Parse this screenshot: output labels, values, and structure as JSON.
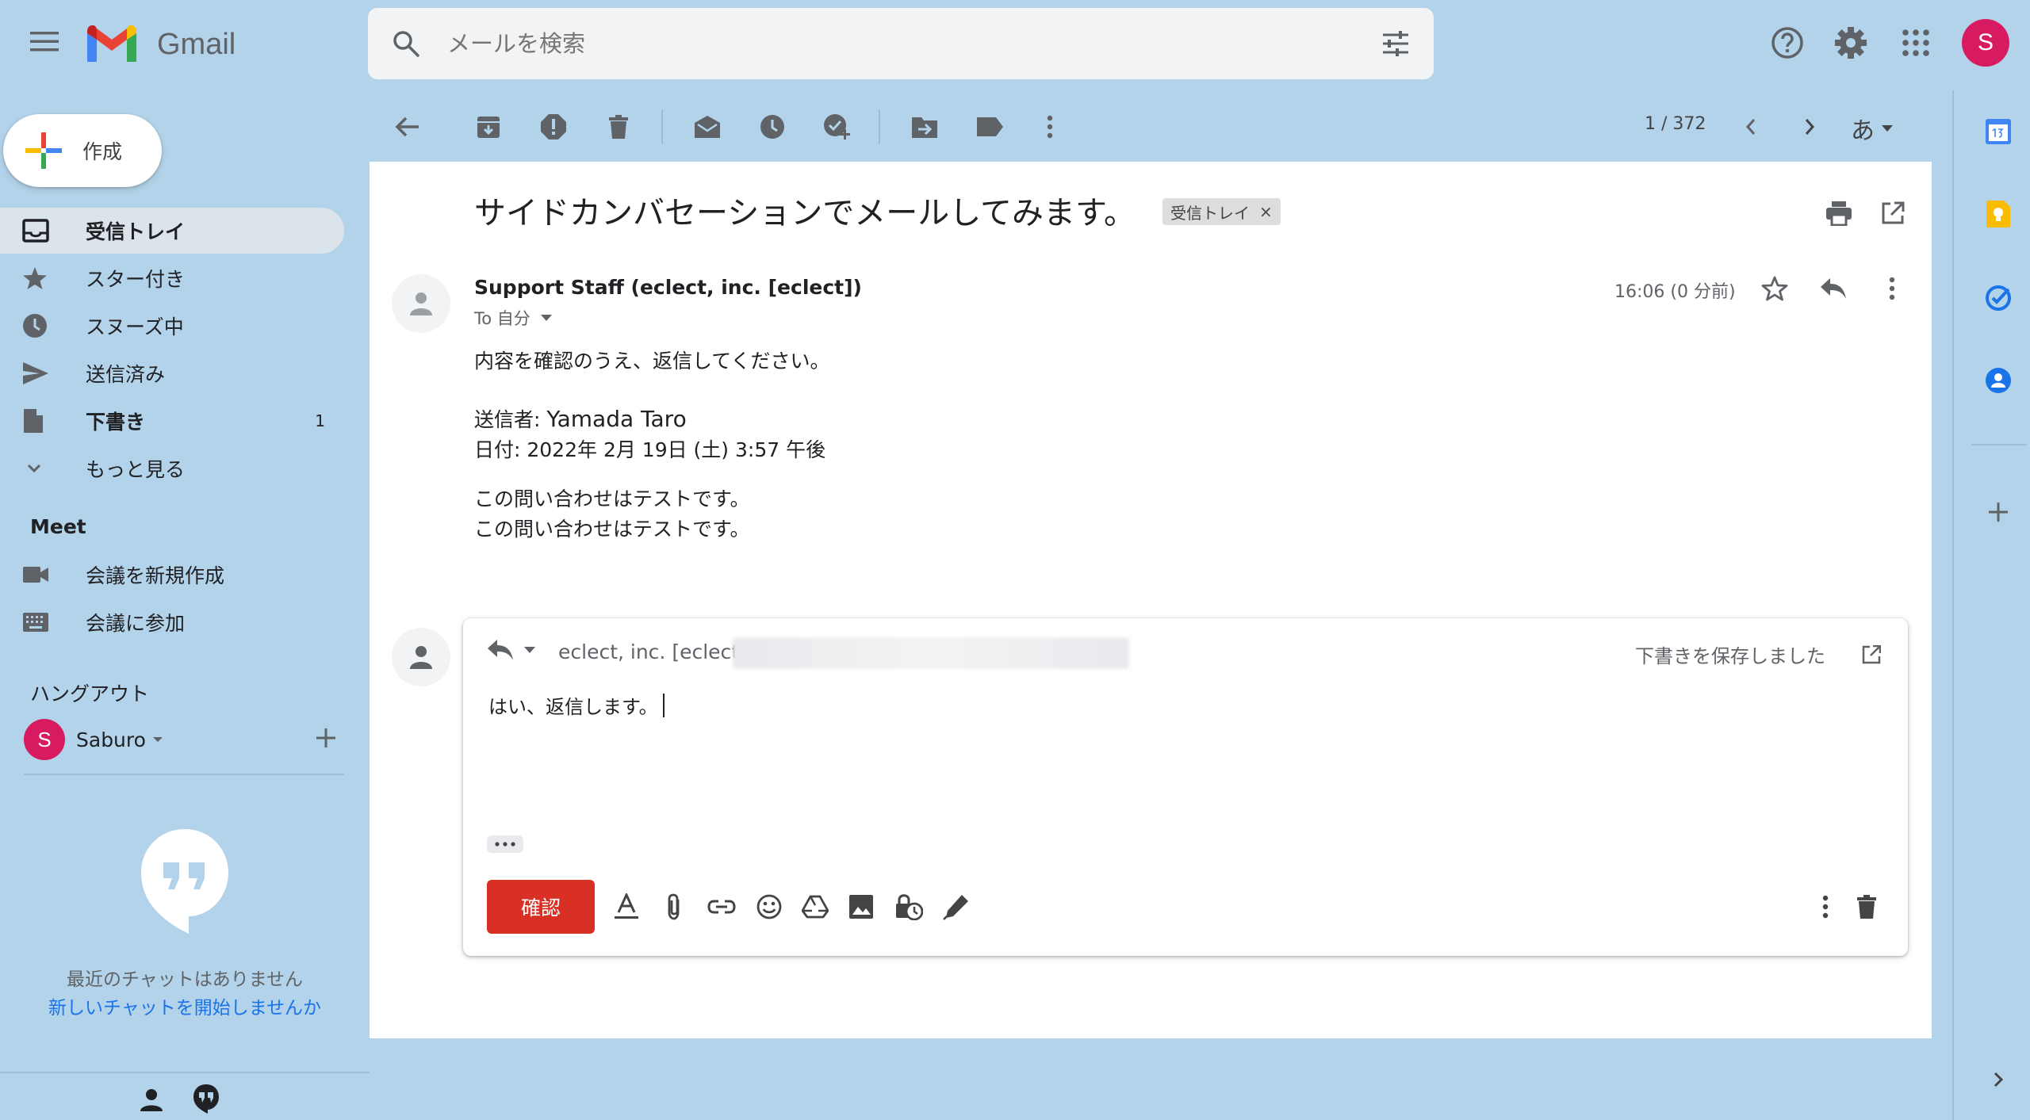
{
  "header": {
    "app_name": "Gmail",
    "search_placeholder": "メールを検索",
    "account_initial": "S"
  },
  "compose": {
    "label": "作成"
  },
  "nav": {
    "items": [
      {
        "label": "受信トレイ",
        "icon": "inbox-icon",
        "active": true,
        "bold": true
      },
      {
        "label": "スター付き",
        "icon": "star-icon"
      },
      {
        "label": "スヌーズ中",
        "icon": "clock-icon"
      },
      {
        "label": "送信済み",
        "icon": "send-icon"
      },
      {
        "label": "下書き",
        "icon": "draft-icon",
        "bold": true,
        "count": "1"
      },
      {
        "label": "もっと見る",
        "icon": "chevron-down-icon"
      }
    ]
  },
  "meet": {
    "heading": "Meet",
    "new_meeting": "会議を新規作成",
    "join_meeting": "会議に参加"
  },
  "hangouts": {
    "heading": "ハングアウト",
    "user_initial": "S",
    "user_name": "Saburo",
    "no_chats": "最近のチャットはありません",
    "start_chat": "新しいチャットを開始しませんか"
  },
  "toolbar": {
    "page_count": "1 / 372",
    "input_tool": "あ"
  },
  "thread": {
    "subject": "サイドカンバセーションでメールしてみます。",
    "label": "受信トレイ",
    "label_close": "×"
  },
  "message": {
    "sender": "Support Staff (eclect, inc. [eclect])",
    "to": "To 自分",
    "time": "16:06 (0 分前)",
    "body_line1": "内容を確認のうえ、返信してください。",
    "sender_label": "送信者: ",
    "sender_value": "Yamada Taro",
    "date_line": "日付: 2022年 2月 19日 (土) 3:57 午後",
    "body_q1": "この問い合わせはテストです。",
    "body_q2": "この問い合わせはテストです。"
  },
  "reply": {
    "recipient": "eclect, inc. [eclect]",
    "draft_status": "下書きを保存しました",
    "text": "はい、返信します。",
    "send_label": "確認"
  },
  "colors": {
    "background": "#b3d3ea",
    "send_button": "#d93025",
    "avatar": "#d81b60",
    "link": "#1a73e8"
  }
}
